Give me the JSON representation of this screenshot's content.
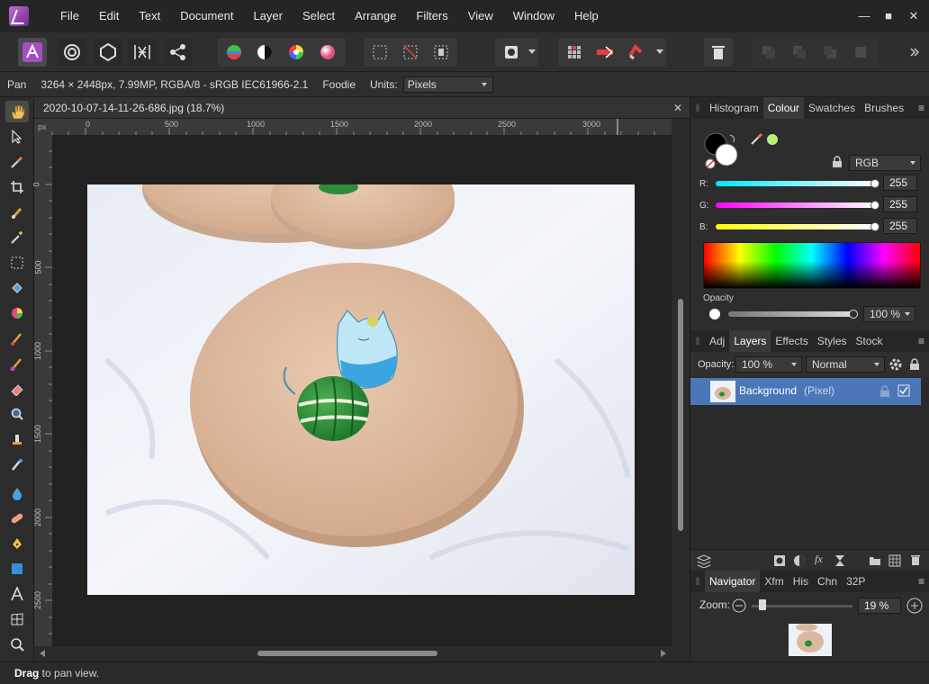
{
  "menu": [
    "File",
    "Edit",
    "Text",
    "Document",
    "Layer",
    "Select",
    "Arrange",
    "Filters",
    "View",
    "Window",
    "Help"
  ],
  "window_controls": {
    "minimize": "—",
    "maximize": "■",
    "close": "✕"
  },
  "context": {
    "tool": "Pan",
    "info": "3264 × 2448px, 7.99MP, RGBA/8 - sRGB IEC61966-2.1",
    "preset": "Foodie",
    "units_label": "Units:",
    "units_value": "Pixels"
  },
  "document": {
    "tab_title": "2020-10-07-14-11-26-686.jpg (18.7%)",
    "ruler_unit": "px",
    "h_ticks": [
      "0",
      "500",
      "1000",
      "1500",
      "2000",
      "2500",
      "3000"
    ],
    "v_ticks": [
      "0",
      "500",
      "1000",
      "1500",
      "2000",
      "2500"
    ]
  },
  "colour_panel": {
    "tabs": [
      "Histogram",
      "Colour",
      "Swatches",
      "Brushes"
    ],
    "selected_tab": "Colour",
    "model": "RGB",
    "channels": [
      {
        "label": "R:",
        "value": "255",
        "color": "#00e5ff"
      },
      {
        "label": "G:",
        "value": "255",
        "color": "#ff00ff"
      },
      {
        "label": "B:",
        "value": "255",
        "color": "#ffff00"
      }
    ],
    "opacity_label": "Opacity",
    "opacity_value": "100 %",
    "accent_swatch": "#b6f07a"
  },
  "layers_panel": {
    "tabs": [
      "Adj",
      "Layers",
      "Effects",
      "Styles",
      "Stock"
    ],
    "selected_tab": "Layers",
    "opacity_label": "Opacity:",
    "opacity_value": "100 %",
    "blend_mode": "Normal",
    "layers": [
      {
        "name": "Background",
        "kind": "(Pixel)"
      }
    ]
  },
  "navigator_panel": {
    "tabs": [
      "Navigator",
      "Xfm",
      "His",
      "Chn",
      "32P"
    ],
    "selected_tab": "Navigator",
    "zoom_label": "Zoom:",
    "zoom_value": "19 %"
  },
  "status": {
    "action": "Drag",
    "text": " to pan view."
  }
}
